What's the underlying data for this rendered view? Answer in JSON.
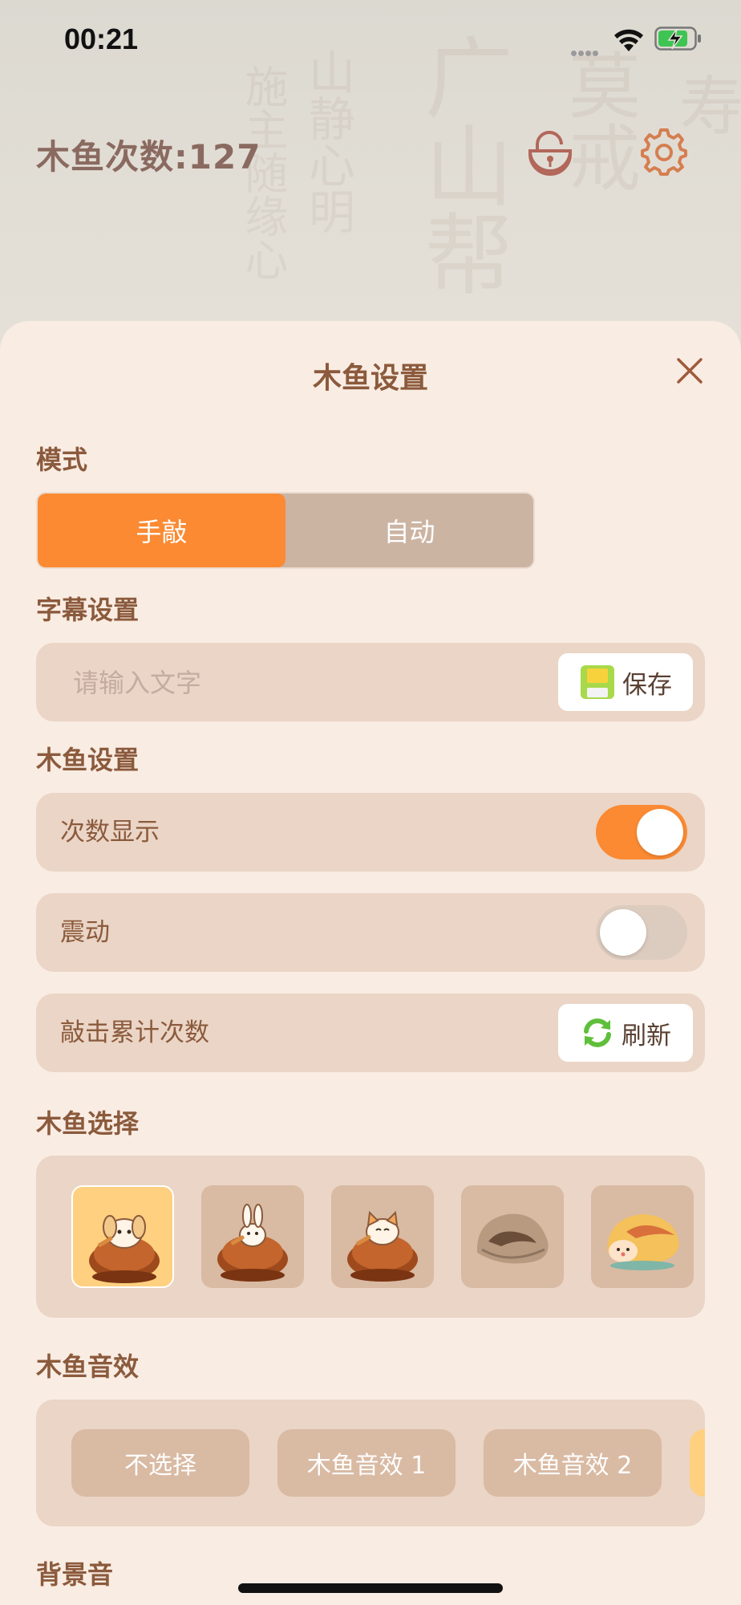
{
  "status_bar": {
    "time": "00:21"
  },
  "header": {
    "counter_label": "木鱼次数:127"
  },
  "sheet": {
    "title": "木鱼设置",
    "mode": {
      "label": "模式",
      "options": [
        "手敲",
        "自动"
      ],
      "selected": "手敲"
    },
    "subtitle": {
      "label": "字幕设置",
      "placeholder": "请输入文字",
      "value": "",
      "save_label": "保存"
    },
    "fish_settings": {
      "label": "木鱼设置",
      "count_display": {
        "label": "次数显示",
        "on": true
      },
      "vibration": {
        "label": "震动",
        "on": false
      },
      "tap_total": {
        "label": "敲击累计次数",
        "refresh_label": "刷新"
      }
    },
    "fish_select": {
      "label": "木鱼选择",
      "items": [
        "puppy-fish-icon",
        "bunny-fish-icon",
        "cat-fish-icon",
        "stone-fish-icon",
        "bird-fish-icon"
      ],
      "selected_index": 0
    },
    "sound": {
      "label": "木鱼音效",
      "options": [
        "不选择",
        "木鱼音效 1",
        "木鱼音效 2"
      ]
    },
    "bgm": {
      "label": "背景音"
    }
  },
  "colors": {
    "accent": "#fb8a33",
    "text_brown": "#8b5a3c",
    "sheet_bg": "#f9ece3",
    "row_bg": "#ead5c6",
    "tile_bg": "#d9baa3",
    "selected_tile": "#fed07f"
  }
}
